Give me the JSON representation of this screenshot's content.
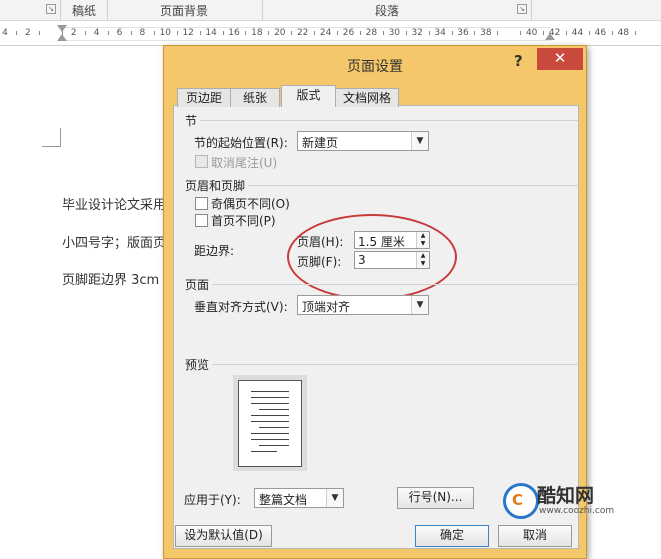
{
  "ribbon": {
    "groups": [
      "稿纸",
      "页面背景",
      "段落"
    ]
  },
  "ruler": {
    "numbers": [
      "4",
      "2",
      "",
      "2",
      "4",
      "6",
      "8",
      "10",
      "12",
      "14",
      "16",
      "18",
      "20",
      "22",
      "24",
      "26",
      "28",
      "30",
      "32",
      "34",
      "36",
      "38",
      "",
      "40",
      "42",
      "44",
      "46",
      "48"
    ]
  },
  "document": {
    "lines": [
      "毕业设计论文采用",
      "小四号字；版面页",
      "页脚距边界 3cm"
    ]
  },
  "dialog": {
    "title": "页面设置",
    "help": "?",
    "close": "✕",
    "tabs": [
      "页边距",
      "纸张",
      "版式",
      "文档网格"
    ],
    "section": {
      "heading": "节",
      "start_label": "节的起始位置(R):",
      "start_value": "新建页",
      "suppress_endnotes": "取消尾注(U)"
    },
    "header_footer": {
      "heading": "页眉和页脚",
      "odd_even": "奇偶页不同(O)",
      "first_page": "首页不同(P)",
      "from_edge": "距边界:",
      "header_label": "页眉(H):",
      "header_value": "1.5 厘米",
      "footer_label": "页脚(F):",
      "footer_value": "3"
    },
    "page": {
      "heading": "页面",
      "valign_label": "垂直对齐方式(V):",
      "valign_value": "顶端对齐"
    },
    "preview": {
      "heading": "预览"
    },
    "apply_to_label": "应用于(Y):",
    "apply_to_value": "整篇文档",
    "line_numbers": "行号(N)...",
    "set_default": "设为默认值(D)",
    "ok": "确定",
    "cancel": "取消"
  },
  "watermark": {
    "name": "酷知网",
    "url": "www.coozhi.com",
    "logo_char": "C"
  },
  "colors": {
    "titlebar": "#f4c86a",
    "close": "#c94a3d",
    "annotation": "#c93a3a"
  }
}
